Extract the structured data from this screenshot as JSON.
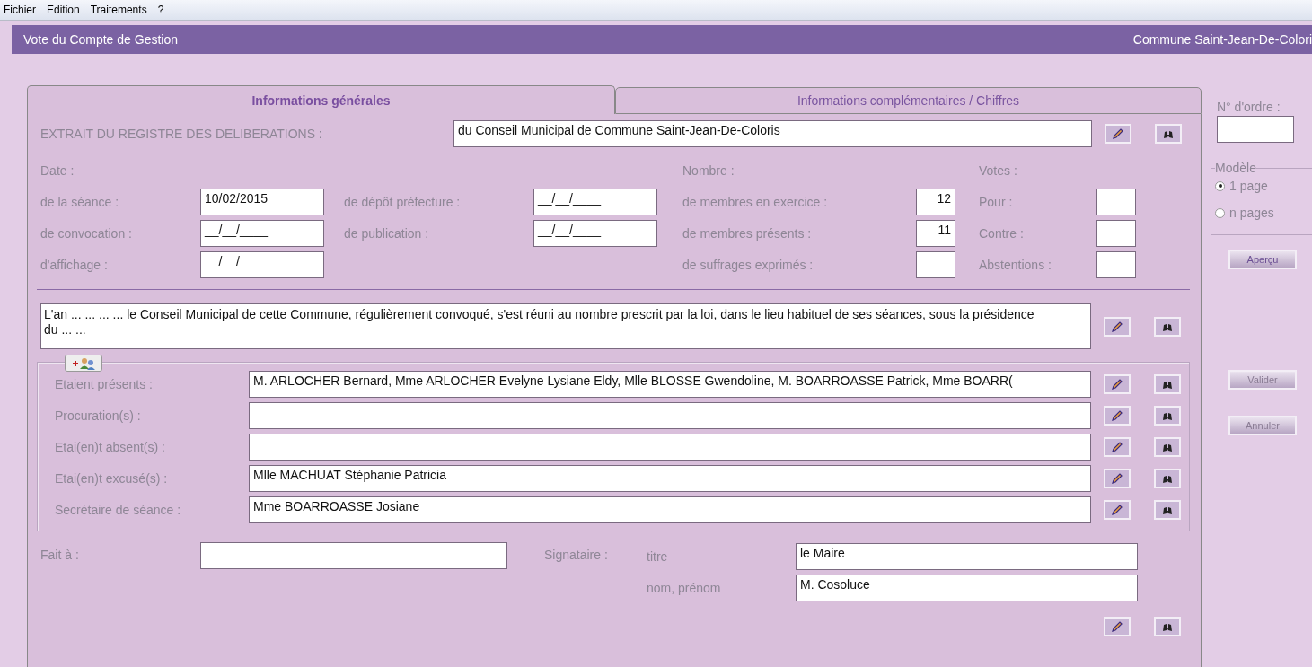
{
  "menu": [
    "Fichier",
    "Edition",
    "Traitements",
    "?"
  ],
  "window": {
    "title": "Vote du Compte de Gestion",
    "commune": "Commune Saint-Jean-De-Colori"
  },
  "tabs": [
    {
      "label": "Informations générales",
      "selected": true
    },
    {
      "label": "Informations complémentaires / Chiffres",
      "selected": false
    }
  ],
  "extrait": {
    "label": "EXTRAIT DU REGISTRE DES DELIBERATIONS :",
    "value": "du Conseil Municipal de Commune Saint-Jean-De-Coloris"
  },
  "columns": [
    {
      "heading": "Date :",
      "kind": "date",
      "fields": [
        {
          "label": "de la séance :",
          "value": "10/02/2015"
        },
        {
          "label": "de convocation :",
          "value": "__/__/____"
        },
        {
          "label": "d'affichage :",
          "value": "__/__/____"
        }
      ]
    },
    {
      "kind": "date",
      "fields": [
        {
          "label": "de dépôt préfecture :",
          "value": "__/__/____"
        },
        {
          "label": "de publication :",
          "value": "__/__/____"
        }
      ]
    },
    {
      "heading": "Nombre :",
      "kind": "number",
      "fields": [
        {
          "label": "de membres en exercice :",
          "value": "12"
        },
        {
          "label": "de membres présents :",
          "value": "11"
        },
        {
          "label": "de suffrages exprimés :"
        }
      ]
    },
    {
      "heading": "Votes :",
      "kind": "number",
      "fields": [
        {
          "label": "Pour :"
        },
        {
          "label": "Contre :"
        },
        {
          "label": "Abstentions :"
        }
      ]
    }
  ],
  "preamble": "L'an ... ... ... ... le Conseil Municipal de cette Commune, régulièrement convoqué, s'est réuni au nombre prescrit par la loi, dans le lieu habituel de ses séances, sous la présidence du ... ...",
  "attendance": [
    {
      "label": "Etaient présents :",
      "value": "M. ARLOCHER Bernard, Mme ARLOCHER Evelyne Lysiane Eldy, Mlle BLOSSE Gwendoline, M. BOARROASSE Patrick, Mme BOARR("
    },
    {
      "label": "Procuration(s) :"
    },
    {
      "label": "Etai(en)t absent(s) :"
    },
    {
      "label": "Etai(en)t excusé(s) :",
      "value": "Mlle MACHUAT Stéphanie  Patricia"
    },
    {
      "label": "Secrétaire de séance :",
      "value": "Mme BOARROASSE Josiane"
    }
  ],
  "fait_a": {
    "label": "Fait à :"
  },
  "signataire": {
    "label": "Signataire :",
    "fields": [
      {
        "label": "titre",
        "value": "le Maire"
      },
      {
        "label": "nom, prénom",
        "value": "M. Cosoluce"
      }
    ]
  },
  "sidebar": {
    "order_label": "N° d'ordre :",
    "model": {
      "legend": "Modèle",
      "options": [
        {
          "label": "1 page",
          "selected": true
        },
        {
          "label": "n pages",
          "selected": false
        }
      ]
    },
    "buttons": [
      {
        "label": "Aperçu",
        "disabled": false
      },
      {
        "label": "Valider",
        "disabled": true
      },
      {
        "label": "Annuler",
        "disabled": true
      }
    ]
  }
}
